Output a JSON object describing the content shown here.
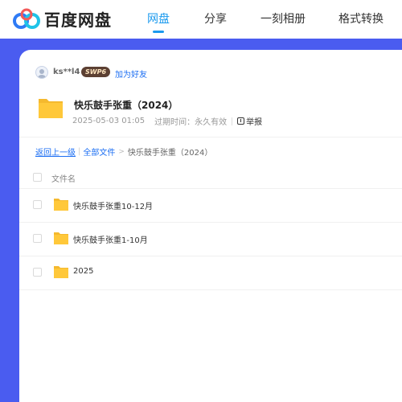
{
  "brand": {
    "name": "百度网盘",
    "logo_icon": "baidu-netdisk-logo-icon"
  },
  "nav": [
    {
      "label": "网盘",
      "active": true
    },
    {
      "label": "分享",
      "active": false
    },
    {
      "label": "一刻相册",
      "active": false
    },
    {
      "label": "格式转换",
      "active": false
    }
  ],
  "user": {
    "name": "ks**l4",
    "badge": "SWP6",
    "add_friend": "加为好友"
  },
  "share": {
    "title": "快乐鼓手张重（2024）",
    "date": "2025-05-03 01:05",
    "expiry": "过期时间：永久有效",
    "report": "举报"
  },
  "breadcrumb": {
    "back": "返回上一级",
    "all_files": "全部文件",
    "arrow": ">",
    "current": "快乐鼓手张重（2024）"
  },
  "list": {
    "column_header": "文件名",
    "rows": [
      {
        "name": "快乐鼓手张重10-12月"
      },
      {
        "name": "快乐鼓手张重1-10月"
      },
      {
        "name": "2025"
      }
    ]
  },
  "colors": {
    "accent": "#1b9aee",
    "background_band": "#4a5cf0",
    "folder": "#ffc83a"
  }
}
